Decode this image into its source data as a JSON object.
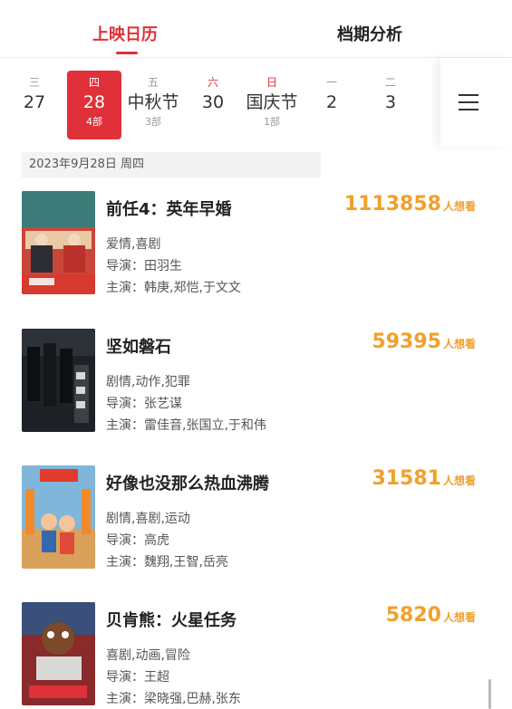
{
  "tabs": {
    "active": "上映日历",
    "inactive": "档期分析"
  },
  "dates": [
    {
      "weekday": "三",
      "label": "27",
      "count": ""
    },
    {
      "weekday": "四",
      "label": "28",
      "count": "4部"
    },
    {
      "weekday": "五",
      "label": "中秋节",
      "count": "3部"
    },
    {
      "weekday": "六",
      "label": "30",
      "count": ""
    },
    {
      "weekday": "日",
      "label": "国庆节",
      "count": "1部"
    },
    {
      "weekday": "一",
      "label": "2",
      "count": ""
    },
    {
      "weekday": "二",
      "label": "3",
      "count": ""
    }
  ],
  "date_header": "2023年9月28日 周四",
  "want_suffix": "人想看",
  "labels": {
    "director": "导演：",
    "cast": "主演："
  },
  "movies": [
    {
      "title": "前任4：英年早婚",
      "want": "1113858",
      "genres": "爱情,喜剧",
      "director": "田羽生",
      "cast": "韩庚,郑恺,于文文"
    },
    {
      "title": "坚如磐石",
      "want": "59395",
      "genres": "剧情,动作,犯罪",
      "director": "张艺谋",
      "cast": "雷佳音,张国立,于和伟"
    },
    {
      "title": "好像也没那么热血沸腾",
      "want": "31581",
      "genres": "剧情,喜剧,运动",
      "director": "高虎",
      "cast": "魏翔,王智,岳亮"
    },
    {
      "title": "贝肯熊：火星任务",
      "want": "5820",
      "genres": "喜剧,动画,冒险",
      "director": "王超",
      "cast": "梁晓强,巴赫,张东"
    }
  ],
  "colors": {
    "accent": "#e0303a",
    "want": "#f1a02c"
  }
}
